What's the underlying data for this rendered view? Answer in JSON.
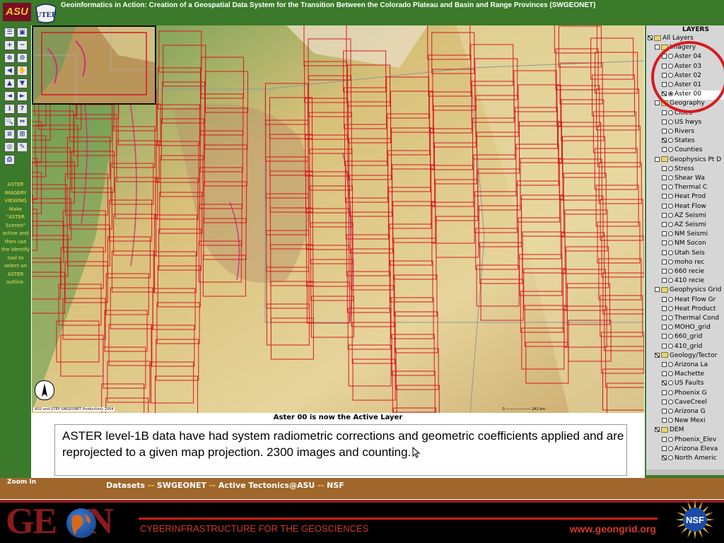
{
  "header": {
    "asu_logo": "ASU",
    "utep_logo": "UTEP",
    "title": "Geoinformatics in Action: Creation of a Geospatial Data System for the Transition Between the Colorado Plateau and Basin and Range Provinces (SWGEONET)"
  },
  "toolbar": {
    "tools": [
      "layers-list-icon",
      "overview-icon",
      "zoom-in-icon",
      "zoom-out-icon",
      "zoom-full-icon",
      "zoom-active-icon",
      "zoom-previous-icon",
      "pan-icon",
      "pan-north-icon",
      "pan-south-icon",
      "pan-west-icon",
      "pan-east-icon",
      "identify-icon",
      "query-icon",
      "find-icon",
      "measure-icon",
      "legend-icon",
      "select-icon",
      "buffer-icon",
      "clear-icon",
      "print-icon"
    ],
    "note": "ASTER IMAGERY VIEWING Make \"ASTER Scenes\" active and then use the Identify tool to select an ASTER outline."
  },
  "map": {
    "credit": "ASU and UTEP SWGEONET Productions 2004",
    "scale_label": "0 ——————— 241 km",
    "colors": {
      "outline": "#d81a20",
      "terrain_low": "#5f9a4e",
      "terrain_mid": "#d8c079",
      "terrain_high": "#b5906a"
    }
  },
  "status": {
    "message": "Aster 00 is now the Active Layer",
    "caption": "ASTER level-1B data have had system radiometric corrections and geometric coefficients applied and are reprojected to a given map projection. 2300 images and counting."
  },
  "layers": {
    "title": "LAYERS",
    "rows": [
      {
        "label": "All Layers",
        "kind": "folder",
        "indent": 0,
        "checked": true
      },
      {
        "label": "Imagery",
        "kind": "folder",
        "indent": 1,
        "checked": false
      },
      {
        "label": "Aster 04",
        "kind": "layer",
        "indent": 2,
        "checked": false,
        "active": false
      },
      {
        "label": "Aster 03",
        "kind": "layer",
        "indent": 2,
        "checked": false,
        "active": false
      },
      {
        "label": "Aster 02",
        "kind": "layer",
        "indent": 2,
        "checked": false,
        "active": false
      },
      {
        "label": "Aster 01",
        "kind": "layer",
        "indent": 2,
        "checked": false,
        "active": false
      },
      {
        "label": "Aster 00",
        "kind": "layer",
        "indent": 2,
        "checked": true,
        "active": true
      },
      {
        "label": "Geography",
        "kind": "folder",
        "indent": 1,
        "checked": false
      },
      {
        "label": "Cities",
        "kind": "layer",
        "indent": 2,
        "checked": false,
        "active": false
      },
      {
        "label": "US hwys",
        "kind": "layer",
        "indent": 2,
        "checked": false,
        "active": false
      },
      {
        "label": "Rivers",
        "kind": "layer",
        "indent": 2,
        "checked": false,
        "active": false
      },
      {
        "label": "States",
        "kind": "layer",
        "indent": 2,
        "checked": true,
        "active": false
      },
      {
        "label": "Counties",
        "kind": "layer",
        "indent": 2,
        "checked": false,
        "active": false
      },
      {
        "label": "Geophysics Pt D",
        "kind": "folder",
        "indent": 1,
        "checked": false
      },
      {
        "label": "Stress",
        "kind": "layer",
        "indent": 2,
        "checked": false,
        "active": false
      },
      {
        "label": "Shear Wa",
        "kind": "layer",
        "indent": 2,
        "checked": false,
        "active": false
      },
      {
        "label": "Thermal C",
        "kind": "layer",
        "indent": 2,
        "checked": false,
        "active": false
      },
      {
        "label": "Heat Prod",
        "kind": "layer",
        "indent": 2,
        "checked": false,
        "active": false
      },
      {
        "label": "Heat Flow",
        "kind": "layer",
        "indent": 2,
        "checked": false,
        "active": false
      },
      {
        "label": "AZ Seismi",
        "kind": "layer",
        "indent": 2,
        "checked": false,
        "active": false
      },
      {
        "label": "AZ Seismi",
        "kind": "layer",
        "indent": 2,
        "checked": false,
        "active": false
      },
      {
        "label": "NM Seismi",
        "kind": "layer",
        "indent": 2,
        "checked": false,
        "active": false
      },
      {
        "label": "NM Socon",
        "kind": "layer",
        "indent": 2,
        "checked": false,
        "active": false
      },
      {
        "label": "Utah Seis",
        "kind": "layer",
        "indent": 2,
        "checked": false,
        "active": false
      },
      {
        "label": "moho rec",
        "kind": "layer",
        "indent": 2,
        "checked": false,
        "active": false
      },
      {
        "label": "660 recie",
        "kind": "layer",
        "indent": 2,
        "checked": false,
        "active": false
      },
      {
        "label": "410 recie",
        "kind": "layer",
        "indent": 2,
        "checked": false,
        "active": false
      },
      {
        "label": "Geophysics Grid",
        "kind": "folder",
        "indent": 1,
        "checked": false
      },
      {
        "label": "Heat Flow Gr",
        "kind": "layer",
        "indent": 2,
        "checked": false,
        "active": false
      },
      {
        "label": "Heat Product",
        "kind": "layer",
        "indent": 2,
        "checked": false,
        "active": false
      },
      {
        "label": "Thermal Cond",
        "kind": "layer",
        "indent": 2,
        "checked": false,
        "active": false
      },
      {
        "label": "MOHO_grid",
        "kind": "layer",
        "indent": 2,
        "checked": false,
        "active": false
      },
      {
        "label": "660_grid",
        "kind": "layer",
        "indent": 2,
        "checked": false,
        "active": false
      },
      {
        "label": "410_grid",
        "kind": "layer",
        "indent": 2,
        "checked": false,
        "active": false
      },
      {
        "label": "Geology/Tector",
        "kind": "folder",
        "indent": 1,
        "checked": true
      },
      {
        "label": "Arizona La",
        "kind": "layer",
        "indent": 2,
        "checked": false,
        "active": false
      },
      {
        "label": "Machette",
        "kind": "layer",
        "indent": 2,
        "checked": false,
        "active": false
      },
      {
        "label": "US Faults",
        "kind": "layer",
        "indent": 2,
        "checked": true,
        "active": false
      },
      {
        "label": "Phoenix G",
        "kind": "layer",
        "indent": 2,
        "checked": false,
        "active": false
      },
      {
        "label": "CaveCreel",
        "kind": "layer",
        "indent": 2,
        "checked": false,
        "active": false
      },
      {
        "label": "Arizona G",
        "kind": "layer",
        "indent": 2,
        "checked": false,
        "active": false
      },
      {
        "label": "New Mexi",
        "kind": "layer",
        "indent": 2,
        "checked": false,
        "active": false
      },
      {
        "label": "DEM",
        "kind": "folder",
        "indent": 1,
        "checked": true
      },
      {
        "label": "Phoenix_Elev",
        "kind": "layer",
        "indent": 2,
        "checked": false,
        "active": false
      },
      {
        "label": "Arizona Eleva",
        "kind": "layer",
        "indent": 2,
        "checked": false,
        "active": false
      },
      {
        "label": "North Americ",
        "kind": "layer",
        "indent": 2,
        "checked": true,
        "active": false
      }
    ]
  },
  "bottom": {
    "zoom_label": "Zoom In",
    "datasets_label": "Datasets",
    "sep": "--",
    "link1": "SWGEONET",
    "link2": "Active Tectonics@ASU",
    "link3": "NSF"
  },
  "footer": {
    "logo_left": "GE",
    "logo_right": "N",
    "tagline": "CYBERINFRASTRUCTURE FOR THE GEOSCIENCES",
    "url": "www.geongrid.org",
    "nsf": "NSF"
  }
}
